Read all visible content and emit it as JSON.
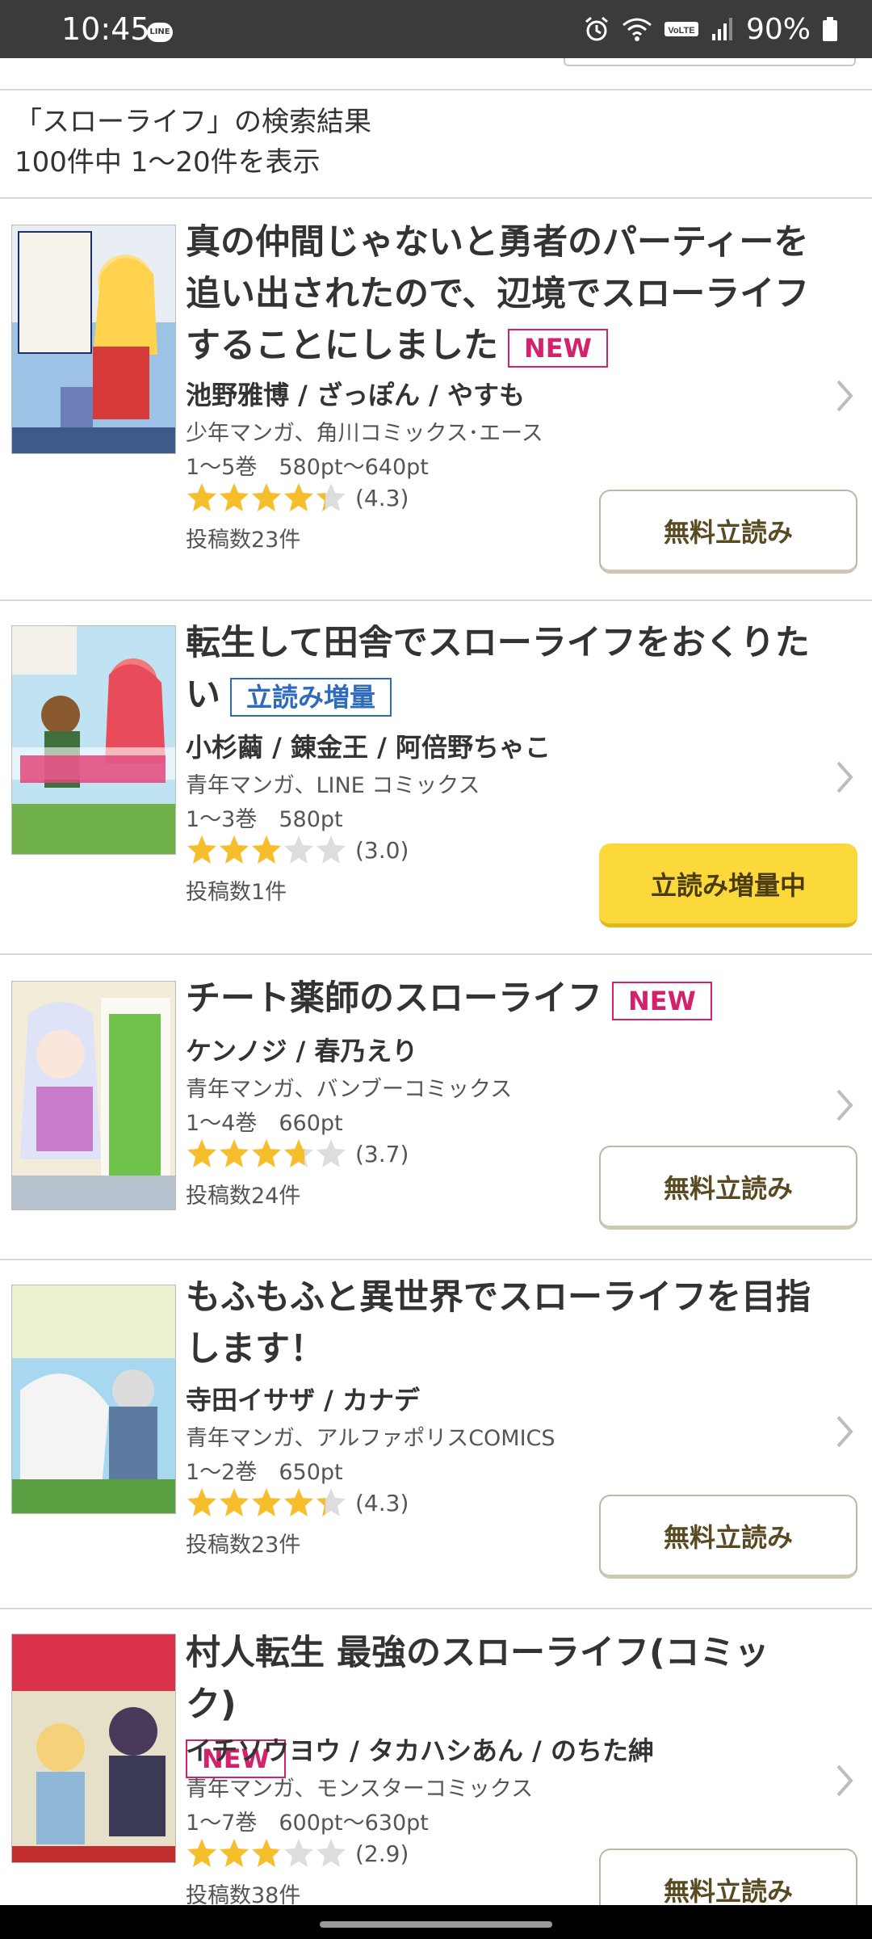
{
  "status_bar": {
    "time": "10:45",
    "line_badge": "LINE",
    "lte_label": "VoLTE",
    "battery_percent": "90%"
  },
  "search": {
    "title": "「スローライフ」の検索結果",
    "count": "100件中 1〜20件を表示"
  },
  "items": [
    {
      "title": "真の仲間じゃないと勇者のパーティーを追い出されたので、辺境でスローライフすることにしました",
      "badge": "NEW",
      "authors": "池野雅博 / ざっぽん / やすも",
      "genre": "少年マンガ、角川コミックス･エース",
      "volumes": "1〜5巻　580pt〜640pt",
      "rating": 4.3,
      "rating_text": "(4.3)",
      "posts": "投稿数23件",
      "button": "無料立読み"
    },
    {
      "title": "転生して田舎でスローライフをおくりたい",
      "badge": "立読み増量",
      "authors": "小杉繭 / 錬金王 / 阿倍野ちゃこ",
      "genre": "青年マンガ、LINE コミックス",
      "volumes": "1〜3巻　580pt",
      "rating": 3.0,
      "rating_text": "(3.0)",
      "posts": "投稿数1件",
      "button": "立読み増量中"
    },
    {
      "title": "チート薬師のスローライフ",
      "badge": "NEW",
      "authors": "ケンノジ / 春乃えり",
      "genre": "青年マンガ、バンブーコミックス",
      "volumes": "1〜4巻　660pt",
      "rating": 3.7,
      "rating_text": "(3.7)",
      "posts": "投稿数24件",
      "button": "無料立読み"
    },
    {
      "title": "もふもふと異世界でスローライフを目指します！",
      "authors": "寺田イサザ / カナデ",
      "genre": "青年マンガ、アルファポリスCOMICS",
      "volumes": "1〜2巻　650pt",
      "rating": 4.3,
      "rating_text": "(4.3)",
      "posts": "投稿数23件",
      "button": "無料立読み"
    },
    {
      "title": "村人転生 最強のスローライフ(コミック)",
      "badge": "NEW",
      "authors": "イチソウヨウ / タカハシあん / のちた紳",
      "genre": "青年マンガ、モンスターコミックス",
      "volumes": "1〜7巻　600pt〜630pt",
      "rating": 2.9,
      "rating_text": "(2.9)",
      "posts": "投稿数38件",
      "button": "無料立読み"
    }
  ],
  "colors": {
    "star_filled": "#f6be2b",
    "star_empty": "#dddddd",
    "badge_new": "#d4216b",
    "badge_boost": "#2f6bbd",
    "button_yellow": "#fbd93a"
  }
}
